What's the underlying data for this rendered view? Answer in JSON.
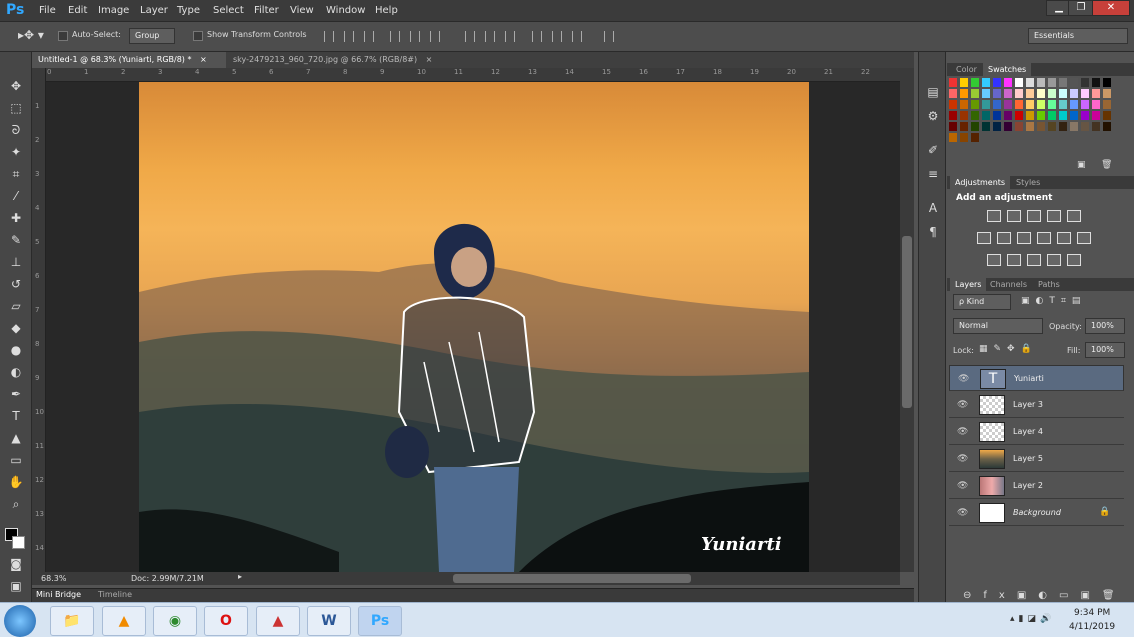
{
  "menubar": {
    "logo": "Ps",
    "items": [
      "File",
      "Edit",
      "Image",
      "Layer",
      "Type",
      "Select",
      "Filter",
      "View",
      "Window",
      "Help"
    ],
    "win_min": "▁",
    "win_max": "❐",
    "win_close": "✕"
  },
  "options": {
    "auto_select": "Auto-Select:",
    "auto_select_value": "Group",
    "show_transform": "Show Transform Controls",
    "workspace": "Essentials"
  },
  "tabs": [
    {
      "label": "Untitled-1 @ 68.3% (Yuniarti, RGB/8) *",
      "close": "×"
    },
    {
      "label": "sky-2479213_960_720.jpg @ 66.7% (RGB/8#)",
      "close": "×"
    }
  ],
  "ruler_h": [
    "0",
    "1",
    "2",
    "3",
    "4",
    "5",
    "6",
    "7",
    "8",
    "9",
    "10",
    "11",
    "12",
    "13",
    "14",
    "15",
    "16",
    "17",
    "18",
    "19",
    "20",
    "21",
    "22"
  ],
  "ruler_v": [
    "1",
    "2",
    "3",
    "4",
    "5",
    "6",
    "7",
    "8",
    "9",
    "10",
    "11",
    "12",
    "13",
    "14"
  ],
  "canvas": {
    "signature": "Yuniarti"
  },
  "status": {
    "zoom": "68.3%",
    "doc": "Doc: 2.99M/7.21M"
  },
  "bottom_tabs": [
    "Mini Bridge",
    "Timeline"
  ],
  "color_panel": {
    "tabs": [
      "Color",
      "Swatches"
    ]
  },
  "adjustments": {
    "tabs": [
      "Adjustments",
      "Styles"
    ],
    "heading": "Add an adjustment"
  },
  "layers_panel": {
    "tabs": [
      "Layers",
      "Channels",
      "Paths"
    ],
    "filter": "ρ Kind",
    "blend_mode": "Normal",
    "opacity_label": "Opacity:",
    "opacity_value": "100%",
    "lock_label": "Lock:",
    "fill_label": "Fill:",
    "fill_value": "100%",
    "layers": [
      {
        "name": "Yuniarti",
        "type": "text"
      },
      {
        "name": "Layer 3",
        "type": "transparent"
      },
      {
        "name": "Layer 4",
        "type": "transparent"
      },
      {
        "name": "Layer 5",
        "type": "sky"
      },
      {
        "name": "Layer 2",
        "type": "photo"
      },
      {
        "name": "Background",
        "type": "white"
      }
    ]
  },
  "clock": {
    "time": "9:34 PM",
    "date": "4/11/2019"
  },
  "colors": {
    "accent_ps": "#31a8ff",
    "selected_layer": "#5a6a80"
  }
}
